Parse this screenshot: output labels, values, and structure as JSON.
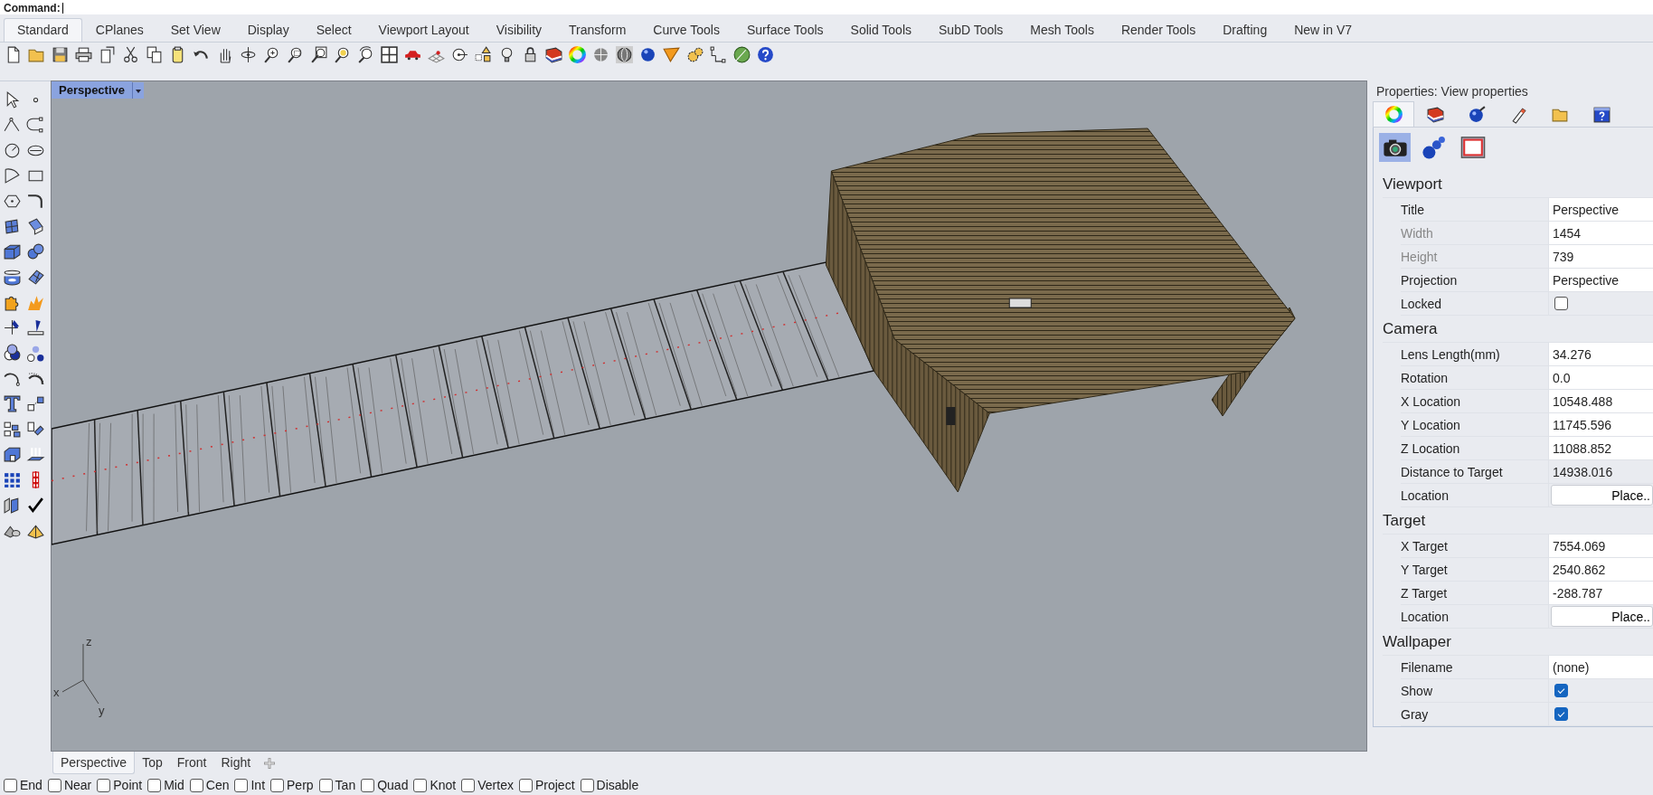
{
  "command_line": {
    "prompt": "Command:"
  },
  "toolbar_tabs": [
    {
      "label": "Standard",
      "selected": true
    },
    {
      "label": "CPlanes",
      "selected": false
    },
    {
      "label": "Set View",
      "selected": false
    },
    {
      "label": "Display",
      "selected": false
    },
    {
      "label": "Select",
      "selected": false
    },
    {
      "label": "Viewport Layout",
      "selected": false
    },
    {
      "label": "Visibility",
      "selected": false
    },
    {
      "label": "Transform",
      "selected": false
    },
    {
      "label": "Curve Tools",
      "selected": false
    },
    {
      "label": "Surface Tools",
      "selected": false
    },
    {
      "label": "Solid Tools",
      "selected": false
    },
    {
      "label": "SubD Tools",
      "selected": false
    },
    {
      "label": "Mesh Tools",
      "selected": false
    },
    {
      "label": "Render Tools",
      "selected": false
    },
    {
      "label": "Drafting",
      "selected": false
    },
    {
      "label": "New in V7",
      "selected": false
    }
  ],
  "viewport": {
    "title": "Perspective",
    "axes": {
      "x": "x",
      "y": "y",
      "z": "z"
    }
  },
  "viewport_tabs": [
    {
      "label": "Perspective",
      "selected": true
    },
    {
      "label": "Top",
      "selected": false
    },
    {
      "label": "Front",
      "selected": false
    },
    {
      "label": "Right",
      "selected": false
    }
  ],
  "properties": {
    "title": "Properties: View properties",
    "tabs": [
      {
        "selected": true
      },
      {
        "selected": false
      },
      {
        "selected": false
      },
      {
        "selected": false
      },
      {
        "selected": false
      },
      {
        "selected": false
      }
    ],
    "pages": [
      {
        "selected": true
      },
      {
        "selected": false
      },
      {
        "selected": false
      }
    ],
    "sections": [
      {
        "title": "Viewport",
        "rows": [
          {
            "label": "Title",
            "kind": "field",
            "value": "Perspective",
            "disabled": false
          },
          {
            "label": "Width",
            "kind": "field",
            "value": "1454",
            "disabled": true
          },
          {
            "label": "Height",
            "kind": "field",
            "value": "739",
            "disabled": true
          },
          {
            "label": "Projection",
            "kind": "field",
            "value": "Perspective",
            "disabled": false
          },
          {
            "label": "Locked",
            "kind": "checkbox",
            "checked": false,
            "disabled": false
          }
        ]
      },
      {
        "title": "Camera",
        "rows": [
          {
            "label": "Lens Length(mm)",
            "kind": "field",
            "value": "34.276",
            "disabled": false
          },
          {
            "label": "Rotation",
            "kind": "field",
            "value": "0.0",
            "disabled": false
          },
          {
            "label": "X Location",
            "kind": "field",
            "value": "10548.488",
            "disabled": false
          },
          {
            "label": "Y Location",
            "kind": "field",
            "value": "11745.596",
            "disabled": false
          },
          {
            "label": "Z Location",
            "kind": "field",
            "value": "11088.852",
            "disabled": false
          },
          {
            "label": "Distance to Target",
            "kind": "readonly",
            "value": "14938.016",
            "disabled": false
          },
          {
            "label": "Location",
            "kind": "button",
            "value": "Place..",
            "disabled": false
          }
        ]
      },
      {
        "title": "Target",
        "rows": [
          {
            "label": "X Target",
            "kind": "field",
            "value": "7554.069",
            "disabled": false
          },
          {
            "label": "Y Target",
            "kind": "field",
            "value": "2540.862",
            "disabled": false
          },
          {
            "label": "Z Target",
            "kind": "field",
            "value": "-288.787",
            "disabled": false
          },
          {
            "label": "Location",
            "kind": "button",
            "value": "Place..",
            "disabled": false
          }
        ]
      },
      {
        "title": "Wallpaper",
        "rows": [
          {
            "label": "Filename",
            "kind": "field",
            "value": "(none)",
            "disabled": false
          },
          {
            "label": "Show",
            "kind": "checkbox",
            "checked": true,
            "disabled": false
          },
          {
            "label": "Gray",
            "kind": "checkbox",
            "checked": true,
            "disabled": false
          }
        ]
      }
    ]
  },
  "osnaps": [
    {
      "label": "End",
      "checked": false
    },
    {
      "label": "Near",
      "checked": false
    },
    {
      "label": "Point",
      "checked": false
    },
    {
      "label": "Mid",
      "checked": false
    },
    {
      "label": "Cen",
      "checked": false
    },
    {
      "label": "Int",
      "checked": false
    },
    {
      "label": "Perp",
      "checked": false
    },
    {
      "label": "Tan",
      "checked": false
    },
    {
      "label": "Quad",
      "checked": false
    },
    {
      "label": "Knot",
      "checked": false
    },
    {
      "label": "Vertex",
      "checked": false
    },
    {
      "label": "Project",
      "checked": false
    },
    {
      "label": "Disable",
      "checked": false
    }
  ]
}
